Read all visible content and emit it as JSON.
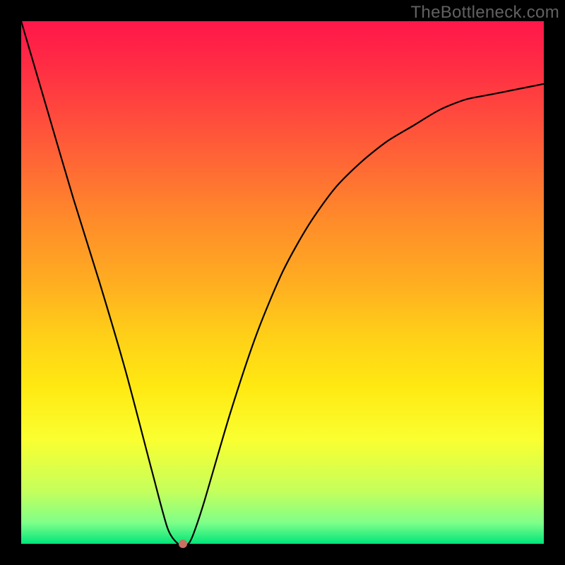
{
  "watermark": "TheBottleneck.com",
  "colors": {
    "frame": "#000000",
    "curve": "#000000",
    "dot": "#c97063",
    "gradient_top": "#ff174a",
    "gradient_mid": "#ffe912",
    "gradient_bottom": "#00e57a"
  },
  "chart_data": {
    "type": "line",
    "title": "",
    "xlabel": "",
    "ylabel": "",
    "xlim": [
      0,
      100
    ],
    "ylim": [
      0,
      100
    ],
    "grid": false,
    "series": [
      {
        "name": "bottleneck-curve",
        "x": [
          0,
          5,
          10,
          15,
          20,
          25,
          28,
          30,
          31,
          32,
          33,
          35,
          40,
          45,
          50,
          55,
          60,
          65,
          70,
          75,
          80,
          85,
          90,
          95,
          100
        ],
        "y": [
          100,
          83,
          66,
          50,
          33,
          14,
          3,
          0,
          0,
          0,
          2,
          8,
          25,
          40,
          52,
          61,
          68,
          73,
          77,
          80,
          83,
          85,
          86,
          87,
          88
        ]
      }
    ],
    "annotations": [
      {
        "type": "point",
        "name": "minimum-marker",
        "x": 31,
        "y": 0
      }
    ]
  }
}
